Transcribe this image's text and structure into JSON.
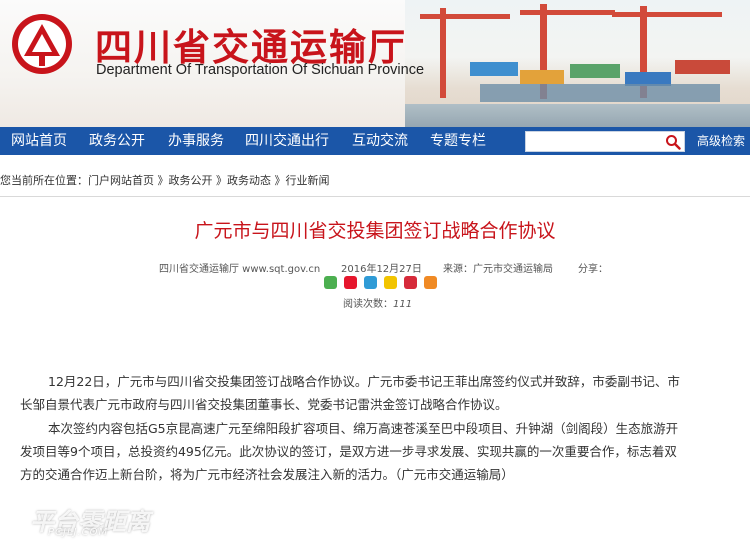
{
  "header": {
    "title_cn": "四川省交通运输厅",
    "title_en": "Department Of Transportation Of Sichuan Province",
    "emblem_icon": "provincial-emblem-icon",
    "brand_color": "#c8141b"
  },
  "nav": {
    "items": [
      {
        "label": "网站首页"
      },
      {
        "label": "政务公开"
      },
      {
        "label": "办事服务"
      },
      {
        "label": "四川交通出行"
      },
      {
        "label": "互动交流"
      },
      {
        "label": "专题专栏"
      }
    ],
    "search_placeholder": "",
    "search_icon": "search-icon",
    "advanced_search": "高级检索",
    "bar_color": "#1b56a8"
  },
  "breadcrumb": {
    "prefix": "您当前所在位置：",
    "items": [
      "门户网站首页",
      "政务公开",
      "政务动态",
      "行业新闻"
    ],
    "separator": " 》"
  },
  "article": {
    "title": "广元市与四川省交投集团签订战略合作协议",
    "source_label": "四川省交通运输厅 www.sqt.gov.cn",
    "date": "2016年12月27日",
    "origin": "来源：广元市交通运输局",
    "share_label": "分享：",
    "share_icons": [
      "wechat-icon",
      "weibo-icon",
      "tencent-weibo-icon",
      "qzone-icon",
      "renren-icon",
      "more-share-icon"
    ],
    "views_label": "阅读次数：",
    "views_count": "111",
    "paragraphs": [
      "12月22日，广元市与四川省交投集团签订战略合作协议。广元市委书记王菲出席签约仪式并致辞，市委副书记、市",
      "长邹自景代表广元市政府与四川省交投集团董事长、党委书记雷洪金签订战略合作协议。",
      "本次签约内容包括G5京昆高速广元至绵阳段扩容项目、绵万高速苍溪至巴中段项目、升钟湖（剑阁段）生态旅游开",
      "发项目等9个项目，总投资约495亿元。此次协议的签订，是双方进一步寻求发展、实现共赢的一次重要合作，标志着双",
      "方的交通合作迈上新台阶，将为广元市经济社会发展注入新的活力。（广元市交通运输局）"
    ]
  },
  "watermark": {
    "text": "平台零距离",
    "sub": "PCJLJ.COM"
  }
}
